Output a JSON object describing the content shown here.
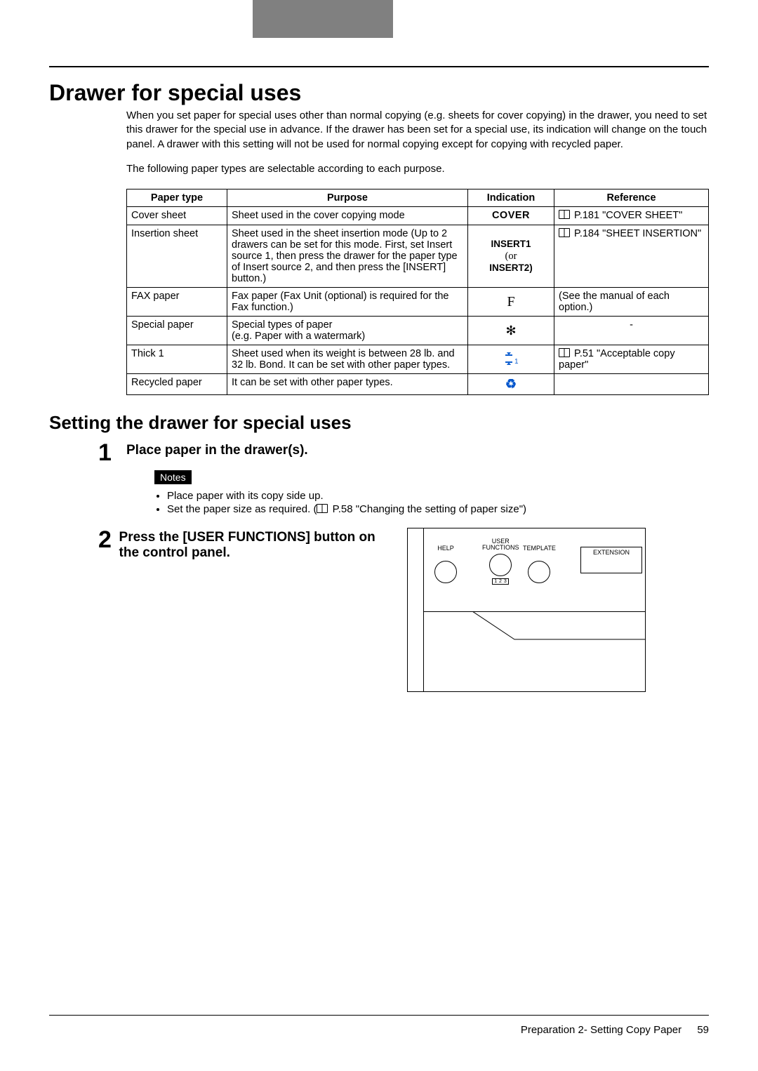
{
  "title": "Drawer for special uses",
  "intro": "When you set paper for special uses other than normal copying (e.g. sheets for cover copying) in the drawer, you need to set this drawer for the special use in advance. If the drawer has been set for a special use, its indication will change on the touch panel. A drawer with this setting will not be used for normal copying except for copying with recycled paper.",
  "body_text": "The following paper types are selectable according to each purpose.",
  "table": {
    "headers": [
      "Paper type",
      "Purpose",
      "Indication",
      "Reference"
    ],
    "rows": [
      {
        "type": "Cover sheet",
        "purpose": "Sheet used in the cover copying mode",
        "indication": "COVER",
        "reference": " P.181 \"COVER SHEET\""
      },
      {
        "type": "Insertion sheet",
        "purpose": "Sheet used in the sheet insertion mode (Up to 2 drawers can be set for this mode. First, set Insert source 1, then press the drawer for the paper type of Insert source 2, and then press the [INSERT] button.)",
        "indication_lines": [
          "INSERT1",
          "(or",
          "INSERT2)"
        ],
        "reference": " P.184 \"SHEET INSERTION\""
      },
      {
        "type": "FAX paper",
        "purpose": "Fax paper (Fax Unit (optional) is required for the Fax function.)",
        "indication": "F",
        "reference": "(See the manual of each option.)"
      },
      {
        "type": "Special paper",
        "purpose": "Special types of paper\n(e.g. Paper with a watermark)",
        "indication": "✻",
        "reference": "-"
      },
      {
        "type": "Thick 1",
        "purpose": "Sheet used when its weight is between 28 lb. and 32 lb. Bond. It can be set with other paper types.",
        "indication": "thick1",
        "reference": " P.51 \"Acceptable copy paper\""
      },
      {
        "type": "Recycled paper",
        "purpose": "It can be set with other paper types.",
        "indication": "♻",
        "reference": ""
      }
    ]
  },
  "section2": "Setting the drawer for special uses",
  "steps": [
    {
      "num": "1",
      "title": "Place paper in the drawer(s).",
      "notes_label": "Notes",
      "bullets": [
        "Place paper with its copy side up.",
        "Set the paper size as required. (📖 P.58 \"Changing the setting of paper size\")"
      ]
    },
    {
      "num": "2",
      "title": "Press the [USER FUNCTIONS] button on the control panel."
    }
  ],
  "panel": {
    "help": "HELP",
    "user": "USER\nFUNCTIONS",
    "template": "TEMPLATE",
    "extension": "EXTENSION",
    "small": "1 2 3"
  },
  "footer": {
    "chapter": "Preparation 2- Setting Copy Paper",
    "page": "59"
  }
}
